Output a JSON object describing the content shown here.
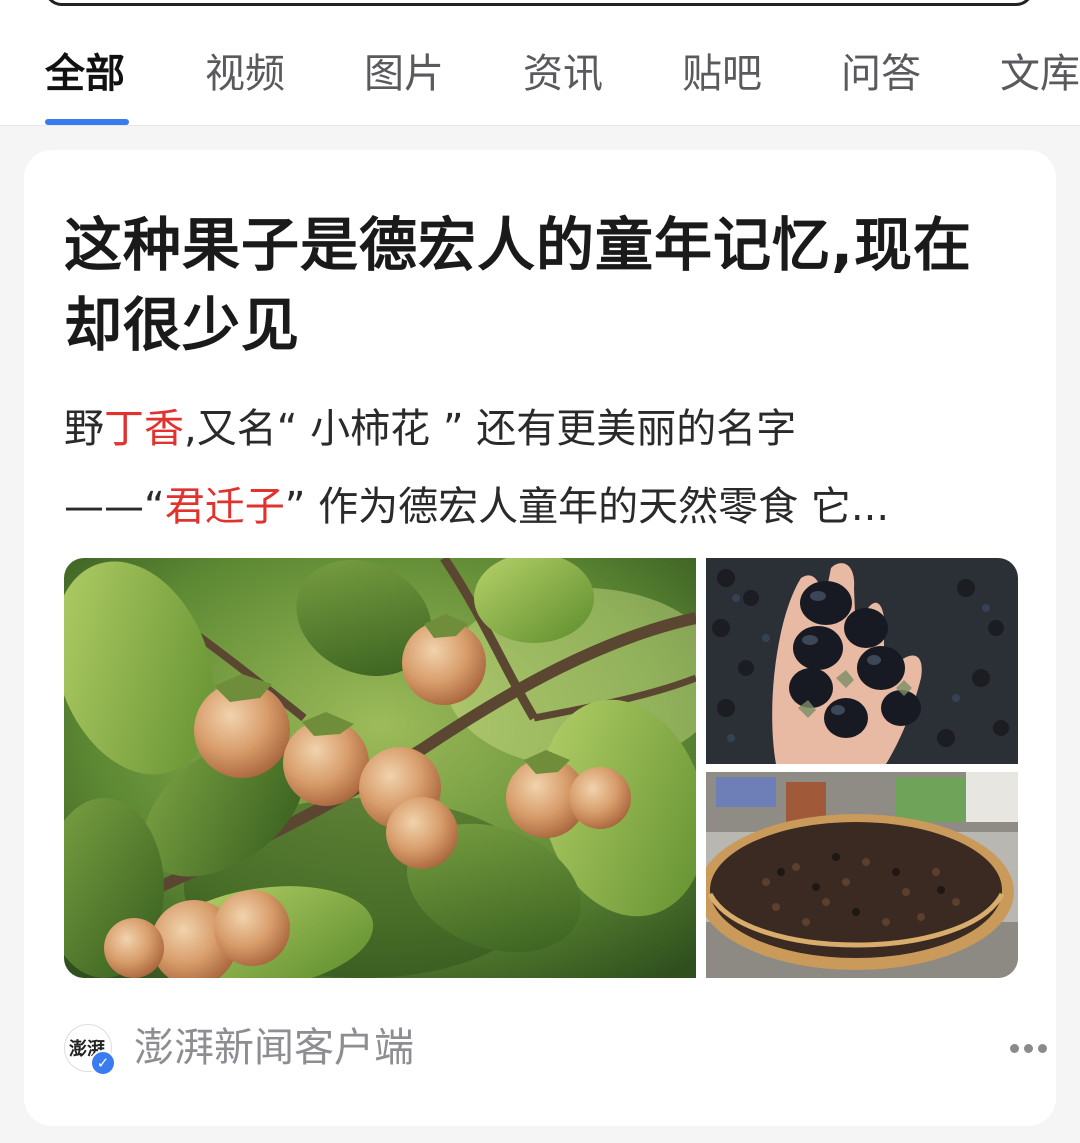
{
  "tabs": [
    {
      "label": "全部",
      "active": true
    },
    {
      "label": "视频"
    },
    {
      "label": "图片"
    },
    {
      "label": "资讯"
    },
    {
      "label": "贴吧"
    },
    {
      "label": "问答"
    },
    {
      "label": "文库"
    }
  ],
  "accent_color": "#3a7bf0",
  "highlight_color": "#e0332e",
  "card": {
    "title": "这种果子是德宏人的童年记忆,现在却很少见",
    "snippet": {
      "line1_pre": "野",
      "line1_hl": "丁香",
      "line1_post": ",又名“ 小柿花 ” 还有更美丽的名字",
      "line2_pre": "——“",
      "line2_hl": "君迁子",
      "line2_post": "” 作为德宏人童年的天然零食 它..."
    },
    "images": [
      {
        "icon": "persimmon-branch-photo"
      },
      {
        "icon": "black-fruit-in-hand-photo"
      },
      {
        "icon": "dried-fruit-basket-photo"
      }
    ],
    "source": {
      "avatar_text": "澎湃",
      "verified_icon": "verified-check-icon",
      "name": "澎湃新闻客户端",
      "more_icon": "more-dots-icon"
    }
  }
}
